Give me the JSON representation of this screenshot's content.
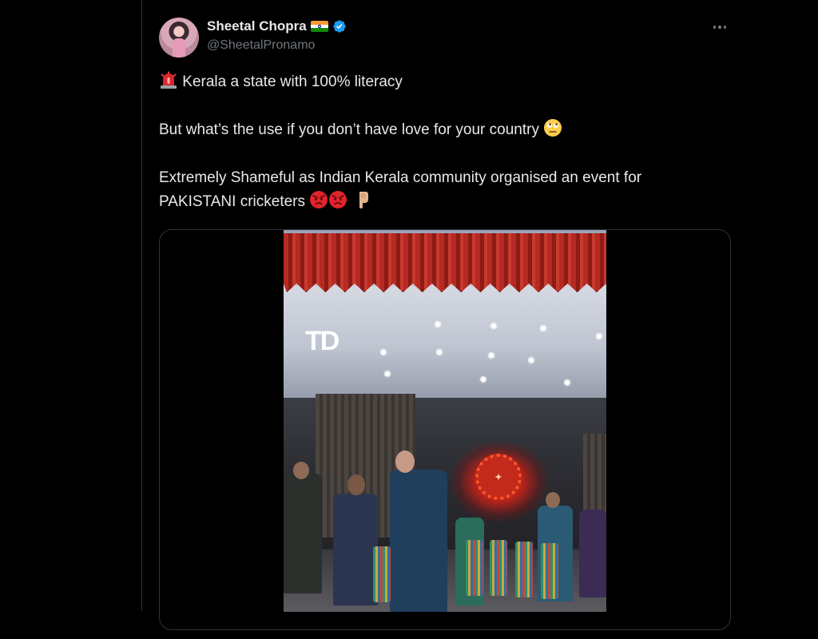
{
  "tweet": {
    "author": {
      "display_name": "Sheetal Chopra",
      "handle": "@SheetalPronamo",
      "flag_icon": "india-flag-icon",
      "verified_icon": "verified-badge-icon",
      "verified_color": "#1d9bf0"
    },
    "more_icon": "more-horizontal-icon",
    "lines": {
      "line1": "Kerala a state with 100% literacy",
      "line2": "But what’s the use if you don’t have love for your country",
      "line3a": "Extremely Shameful as Indian Kerala community organised an event for",
      "line3b": "PAKISTANI cricketers"
    },
    "emojis": {
      "line1": "rotating-light-emoji",
      "line2": "face-with-rolling-eyes-emoji",
      "line3": [
        "angry-face-emoji",
        "angry-face-emoji",
        "backhand-index-pointing-down-emoji"
      ]
    },
    "media": {
      "type": "video",
      "watermark": "TD"
    }
  },
  "colors": {
    "background": "#000000",
    "text": "#e7e9ea",
    "secondary_text": "#71767b",
    "border": "#2f3336"
  }
}
